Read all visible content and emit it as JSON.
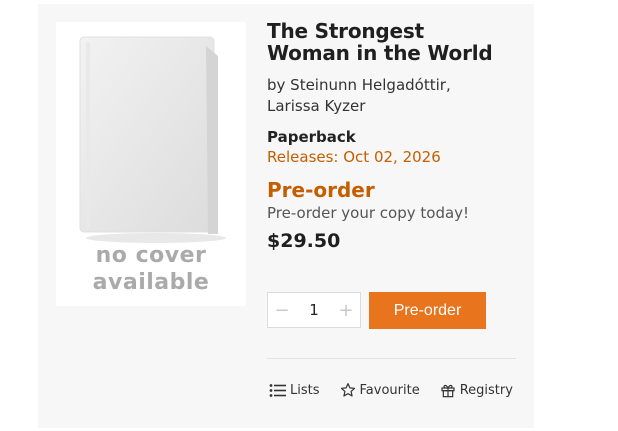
{
  "book": {
    "cover_text_line1": "no cover",
    "cover_text_line2": "available",
    "title_line1": "The Strongest",
    "title_line2": "Woman in the World",
    "authors_line1": "by Steinunn Helgadóttir,",
    "authors_line2": "Larissa Kyzer",
    "format": "Paperback",
    "release": "Releases: Oct 02, 2026",
    "status": "Pre-order",
    "status_sub": "Pre-order your copy today!",
    "price": "$29.50"
  },
  "purchase": {
    "decrement": "−",
    "quantity": "1",
    "increment": "+",
    "button_label": "Pre-order"
  },
  "actions": [
    {
      "label": "Lists",
      "icon": "list-icon"
    },
    {
      "label": "Favourite",
      "icon": "star-icon"
    },
    {
      "label": "Registry",
      "icon": "gift-icon"
    }
  ],
  "colors": {
    "accent": "#e8741d",
    "status_text": "#c45e00"
  }
}
